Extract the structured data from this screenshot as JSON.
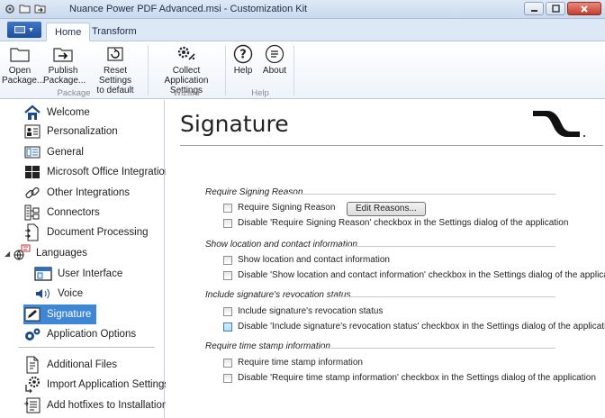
{
  "window": {
    "title": "Nuance Power PDF Advanced.msi - Customization Kit"
  },
  "tabs": [
    {
      "label": "Home",
      "active": true
    },
    {
      "label": "Transform",
      "active": false
    }
  ],
  "ribbon": {
    "package_group_label": "Package",
    "wizard_group_label": "Wizard",
    "help_group_label": "Help",
    "buttons": {
      "open": [
        "Open",
        "Package..."
      ],
      "publish": [
        "Publish",
        "Package..."
      ],
      "reset": [
        "Reset Settings",
        "to default"
      ],
      "collect": [
        "Collect",
        "Application Settings"
      ],
      "help": [
        "Help"
      ],
      "about": [
        "About"
      ]
    }
  },
  "nav": {
    "items": [
      {
        "label": "Welcome",
        "icon": "house-icon"
      },
      {
        "label": "Personalization",
        "icon": "id-card-icon"
      },
      {
        "label": "General",
        "icon": "general-icon"
      },
      {
        "label": "Microsoft Office Integration",
        "icon": "windows-icon"
      },
      {
        "label": "Other Integrations",
        "icon": "chain-link-icon"
      },
      {
        "label": "Connectors",
        "icon": "connectors-icon"
      },
      {
        "label": "Document Processing",
        "icon": "document-processing-icon"
      },
      {
        "label": "Languages",
        "icon": "languages-icon"
      },
      {
        "label": "User Interface",
        "icon": "window-icon"
      },
      {
        "label": "Voice",
        "icon": "speaker-icon"
      },
      {
        "label": "Signature",
        "icon": "pen-icon"
      },
      {
        "label": "Application Options",
        "icon": "gears-icon"
      },
      {
        "label": "Additional Files",
        "icon": "file-icon"
      },
      {
        "label": "Import Application Settings",
        "icon": "import-gear-icon"
      },
      {
        "label": "Add hotfixes to Installation",
        "icon": "hotfix-icon"
      }
    ],
    "selected": "Signature"
  },
  "page": {
    "title": "Signature",
    "sections": [
      {
        "heading": "Require Signing Reason",
        "options": [
          {
            "label": "Require Signing Reason",
            "checked": false
          },
          {
            "label": "Disable 'Require Signing Reason' checkbox in the Settings dialog of the application",
            "checked": false
          }
        ],
        "button": "Edit Reasons..."
      },
      {
        "heading": "Show location and contact information",
        "options": [
          {
            "label": "Show location and contact information",
            "checked": false
          },
          {
            "label": "Disable 'Show location and contact information' checkbox in the Settings dialog of the application",
            "checked": false
          }
        ]
      },
      {
        "heading": "Include signature's revocation status",
        "options": [
          {
            "label": "Include signature's revocation status",
            "checked": false
          },
          {
            "label": "Disable 'Include signature's revocation status' checkbox in the Settings dialog of the application",
            "checked": false
          }
        ]
      },
      {
        "heading": "Require time stamp information",
        "options": [
          {
            "label": "Require time stamp information",
            "checked": false
          },
          {
            "label": "Disable 'Require time stamp information' checkbox in the Settings dialog of the application",
            "checked": false
          }
        ]
      }
    ]
  },
  "colors": {
    "selection": "#3f86d4",
    "ribbon_file_button": "#2a5db0",
    "close_button": "#c33f2e"
  }
}
